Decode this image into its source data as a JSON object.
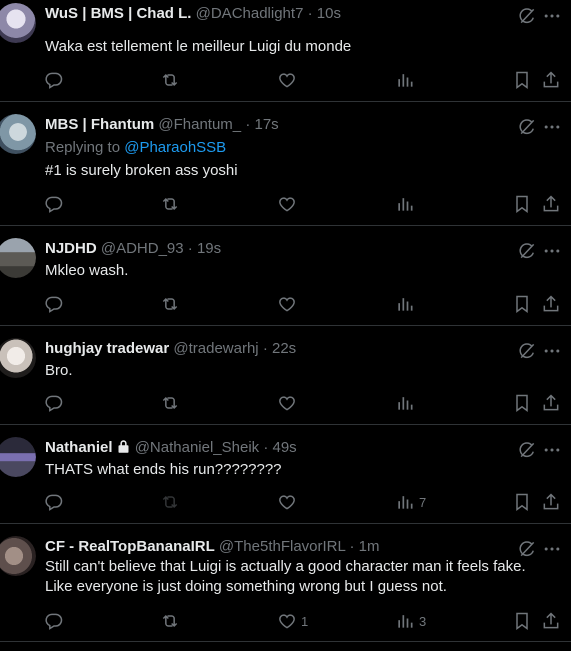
{
  "tweets": [
    {
      "name": "WuS | BMS | Chad L.",
      "handle": "@DAChadlight7",
      "time": "10s",
      "locked": false,
      "replying_to": null,
      "text": "Waka est tellement le meilleur Luigi du monde",
      "likes": "",
      "views": "",
      "retweet_disabled": false,
      "avatar_color": "#b9b6c9"
    },
    {
      "name": "MBS | Fhantum",
      "handle": "@Fhantum_",
      "time": "17s",
      "locked": false,
      "replying_to": {
        "prefix": "Replying to",
        "mention": "@PharaohSSB"
      },
      "text": "#1 is surely broken ass yoshi",
      "likes": "",
      "views": "",
      "retweet_disabled": false,
      "avatar_color": "#a9b9c4"
    },
    {
      "name": "NJDHD",
      "handle": "@ADHD_93",
      "time": "19s",
      "locked": false,
      "replying_to": null,
      "text": "Mkleo wash.",
      "likes": "",
      "views": "",
      "retweet_disabled": false,
      "avatar_color": "#6b6d73"
    },
    {
      "name": "hughjay tradewar",
      "handle": "@tradewarhj",
      "time": "22s",
      "locked": false,
      "replying_to": null,
      "text": "Bro.",
      "likes": "",
      "views": "",
      "retweet_disabled": false,
      "avatar_color": "#d8d3cf"
    },
    {
      "name": "Nathaniel",
      "handle": "@Nathaniel_Sheik",
      "time": "49s",
      "locked": true,
      "replying_to": null,
      "text": "THATS what ends his run????????",
      "likes": "",
      "views": "7",
      "retweet_disabled": true,
      "avatar_color": "#5a5870"
    },
    {
      "name": "CF - RealTopBananaIRL",
      "handle": "@The5thFlavorIRL",
      "time": "1m",
      "locked": false,
      "replying_to": null,
      "text": "Still can't believe that Luigi is actually a good character man it feels fake. Like everyone is just doing something wrong but I guess not.",
      "likes": "1",
      "views": "3",
      "retweet_disabled": false,
      "avatar_color": "#7a6b68"
    }
  ],
  "ui": {
    "separator": "·",
    "colors": {
      "background": "#000000",
      "text": "#e7e9ea",
      "muted": "#71767b",
      "link": "#1d9bf0",
      "divider": "#2f3336"
    },
    "icons": [
      "reply-icon",
      "retweet-icon",
      "like-icon",
      "views-icon",
      "bookmark-icon",
      "share-icon",
      "grok-icon",
      "more-icon",
      "lock-icon"
    ]
  }
}
